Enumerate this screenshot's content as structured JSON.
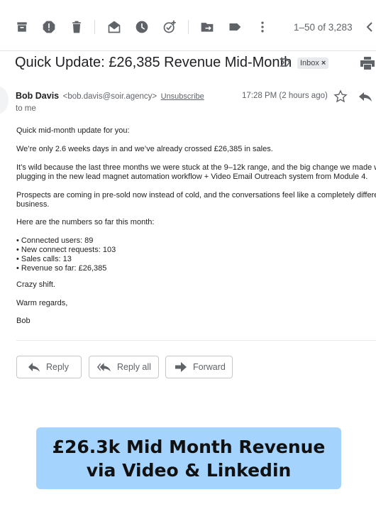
{
  "toolbar": {
    "icons": [
      "archive-icon",
      "report-spam-icon",
      "delete-icon",
      "mark-unread-icon",
      "snooze-icon",
      "add-task-icon",
      "move-to-icon",
      "label-icon",
      "more-vert-icon",
      "older-chevron-icon"
    ],
    "pager": "1–50 of 3,283"
  },
  "email": {
    "subject": "Quick Update: £26,385 Revenue Mid-Month",
    "label": "Inbox",
    "label_close": "×",
    "sender_name": "Bob Davis",
    "sender_email": "<bob.davis@soir.agency>",
    "unsubscribe": "Unsubscribe",
    "recipient": "to me",
    "time": "17:28 PM (2 hours ago)",
    "body": {
      "p1": "Quick mid-month update for you:",
      "p2": "We’re only 2.6 weeks days in and we’ve already crossed £26,385 in sales.",
      "p3_line1": "It’s wild because the last three months we were stuck at the 9–12k range, and the big change we made wa",
      "p3_line2": "plugging in the new lead magnet automation workflow + Video Email Outreach system from Module 4.",
      "p4_line1": "Prospects are coming in pre-sold now instead of cold, and the conversations feel like a completely differen",
      "p4_line2": "business.",
      "p5": "Here are the numbers so far this month:",
      "bullets": [
        "• Connected users: 89",
        "• New connect requests: 103",
        "• Sales calls: 13",
        "• Revenue so far: £26,385"
      ],
      "p7": "Crazy shift.",
      "p8": "Warm regards,",
      "p9": "Bob"
    }
  },
  "actions": {
    "reply": "Reply",
    "reply_all": "Reply all",
    "forward": "Forward"
  },
  "banner": {
    "line1": "£26.3k Mid Month Revenue",
    "line2": "via Video & Linkedin",
    "color": "#a4d3fd"
  }
}
